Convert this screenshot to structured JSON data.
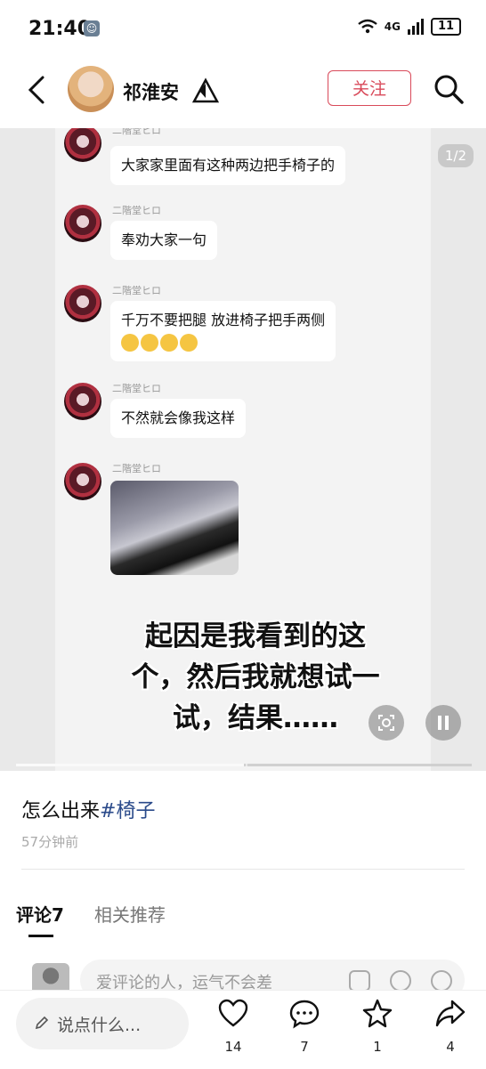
{
  "status": {
    "time": "21:40",
    "sim_badge": "☺",
    "network": "4G",
    "battery": "11"
  },
  "header": {
    "username": "祁淮安",
    "follow_label": "关注"
  },
  "media": {
    "pager": "1/2",
    "messages": [
      {
        "nick": "二階堂ヒロ",
        "text": "大家家里面有这种两边把手椅子的"
      },
      {
        "nick": "二階堂ヒロ",
        "text": "奉劝大家一句"
      },
      {
        "nick": "二階堂ヒロ",
        "text": "千万不要把腿 放进椅子把手两侧"
      },
      {
        "nick": "二階堂ヒロ",
        "text": "不然就会像我这样"
      },
      {
        "nick": "二階堂ヒロ",
        "text": ""
      }
    ],
    "caption_line1": "起因是我看到的这",
    "caption_line2": "个，然后我就想试一",
    "caption_line3": "试，结果……",
    "progress": 0.5
  },
  "post": {
    "title": "怎么出来",
    "tag": "#椅子",
    "time": "57分钟前"
  },
  "tabs": {
    "comments": "评论7",
    "related": "相关推荐"
  },
  "comment_input": {
    "placeholder": "爱评论的人，运气不会差"
  },
  "bottom": {
    "input_label": "说点什么...",
    "like_count": "14",
    "comment_count": "7",
    "fav_count": "1",
    "share_count": "4"
  }
}
